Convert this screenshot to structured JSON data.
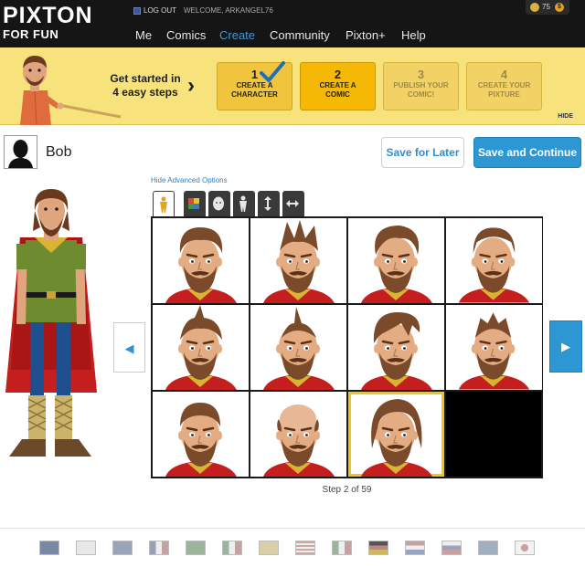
{
  "topbar": {
    "logo_main": "PIXTON",
    "logo_sub": "FOR FUN",
    "logout_label": "LOG OUT",
    "welcome_text": "WELCOME, ARKANGEL76",
    "coin_count": "75",
    "badge_label": "$",
    "nav": [
      "Me",
      "Comics",
      "Create",
      "Community",
      "Pixton+",
      "Help"
    ],
    "active_nav": "Create",
    "accent_color": "#3a9ad9"
  },
  "banner": {
    "intro_line1": "Get started in",
    "intro_line2": "4 easy steps",
    "steps": [
      {
        "number": "1",
        "label_line1": "CREATE A",
        "label_line2": "CHARACTER",
        "state": "done"
      },
      {
        "number": "2",
        "label_line1": "CREATE A",
        "label_line2": "COMIC",
        "state": "current"
      },
      {
        "number": "3",
        "label_line1": "PUBLISH YOUR",
        "label_line2": "COMIC!",
        "state": "future"
      },
      {
        "number": "4",
        "label_line1": "CREATE YOUR",
        "label_line2": "PIXTURE",
        "state": "future"
      }
    ],
    "hide_label": "HIDE",
    "background_color": "#f7e27c"
  },
  "character": {
    "name_value": "Bob"
  },
  "actions": {
    "save_later_label": "Save for Later",
    "save_continue_label": "Save and Continue",
    "primary_color": "#2d97d4"
  },
  "editor": {
    "advanced_link": "Hide Advanced Options",
    "tools": [
      "body-pose-icon",
      "color-palette-icon",
      "head-icon",
      "body-shape-icon",
      "height-icon",
      "width-icon"
    ],
    "active_tool": "body-pose-icon",
    "selected_cell": 9,
    "step_text": "Step 2 of 59",
    "prev_icon": "arrow-left-icon",
    "next_icon": "arrow-right-icon"
  },
  "footer": {
    "flags": [
      "flag-uk-icon",
      "flag-canada-icon",
      "flag-quebec-icon",
      "flag-france-icon",
      "flag-brazil-icon",
      "flag-mexico-icon",
      "flag-catalonia-icon",
      "flag-usa-icon",
      "flag-italy-icon",
      "flag-germany-icon",
      "flag-netherlands-icon",
      "flag-slovakia-icon",
      "flag-sweden-icon",
      "flag-japan-icon"
    ]
  }
}
